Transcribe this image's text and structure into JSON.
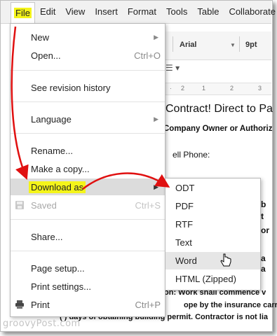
{
  "menubar": {
    "items": [
      "File",
      "Edit",
      "View",
      "Insert",
      "Format",
      "Tools",
      "Table",
      "Collaborate"
    ]
  },
  "toolbar": {
    "font": "Arial",
    "size": "9pt",
    "ruler": [
      "2",
      "1",
      "2",
      "3"
    ]
  },
  "document": {
    "title": "Contract! Direct to Pa",
    "owner_line": "Company Owner or Authoriz",
    "phone": "ell Phone:",
    "fragments": [
      "b",
      "t",
      "or",
      "a",
      "a"
    ],
    "line1": "on: Work shall commence v",
    "line2": "ope by the insurance carrie",
    "line3": "( ) days of obtaining building permit. Contractor is not lia"
  },
  "file_menu": {
    "new": "New",
    "open": "Open...",
    "open_shortcut": "Ctrl+O",
    "revision": "See revision history",
    "language": "Language",
    "rename": "Rename...",
    "copy": "Make a copy...",
    "download": "Download as",
    "saved": "Saved",
    "saved_shortcut": "Ctrl+S",
    "share": "Share...",
    "page_setup": "Page setup...",
    "print_settings": "Print settings...",
    "print": "Print",
    "print_shortcut": "Ctrl+P"
  },
  "download_menu": {
    "items": [
      "ODT",
      "PDF",
      "RTF",
      "Text",
      "Word",
      "HTML (Zipped)"
    ]
  },
  "watermark": "groovyPost.com",
  "colors": {
    "highlight": "#f4f41a",
    "arrow": "#e01010",
    "menubar_bg": "#f1f1f1"
  }
}
